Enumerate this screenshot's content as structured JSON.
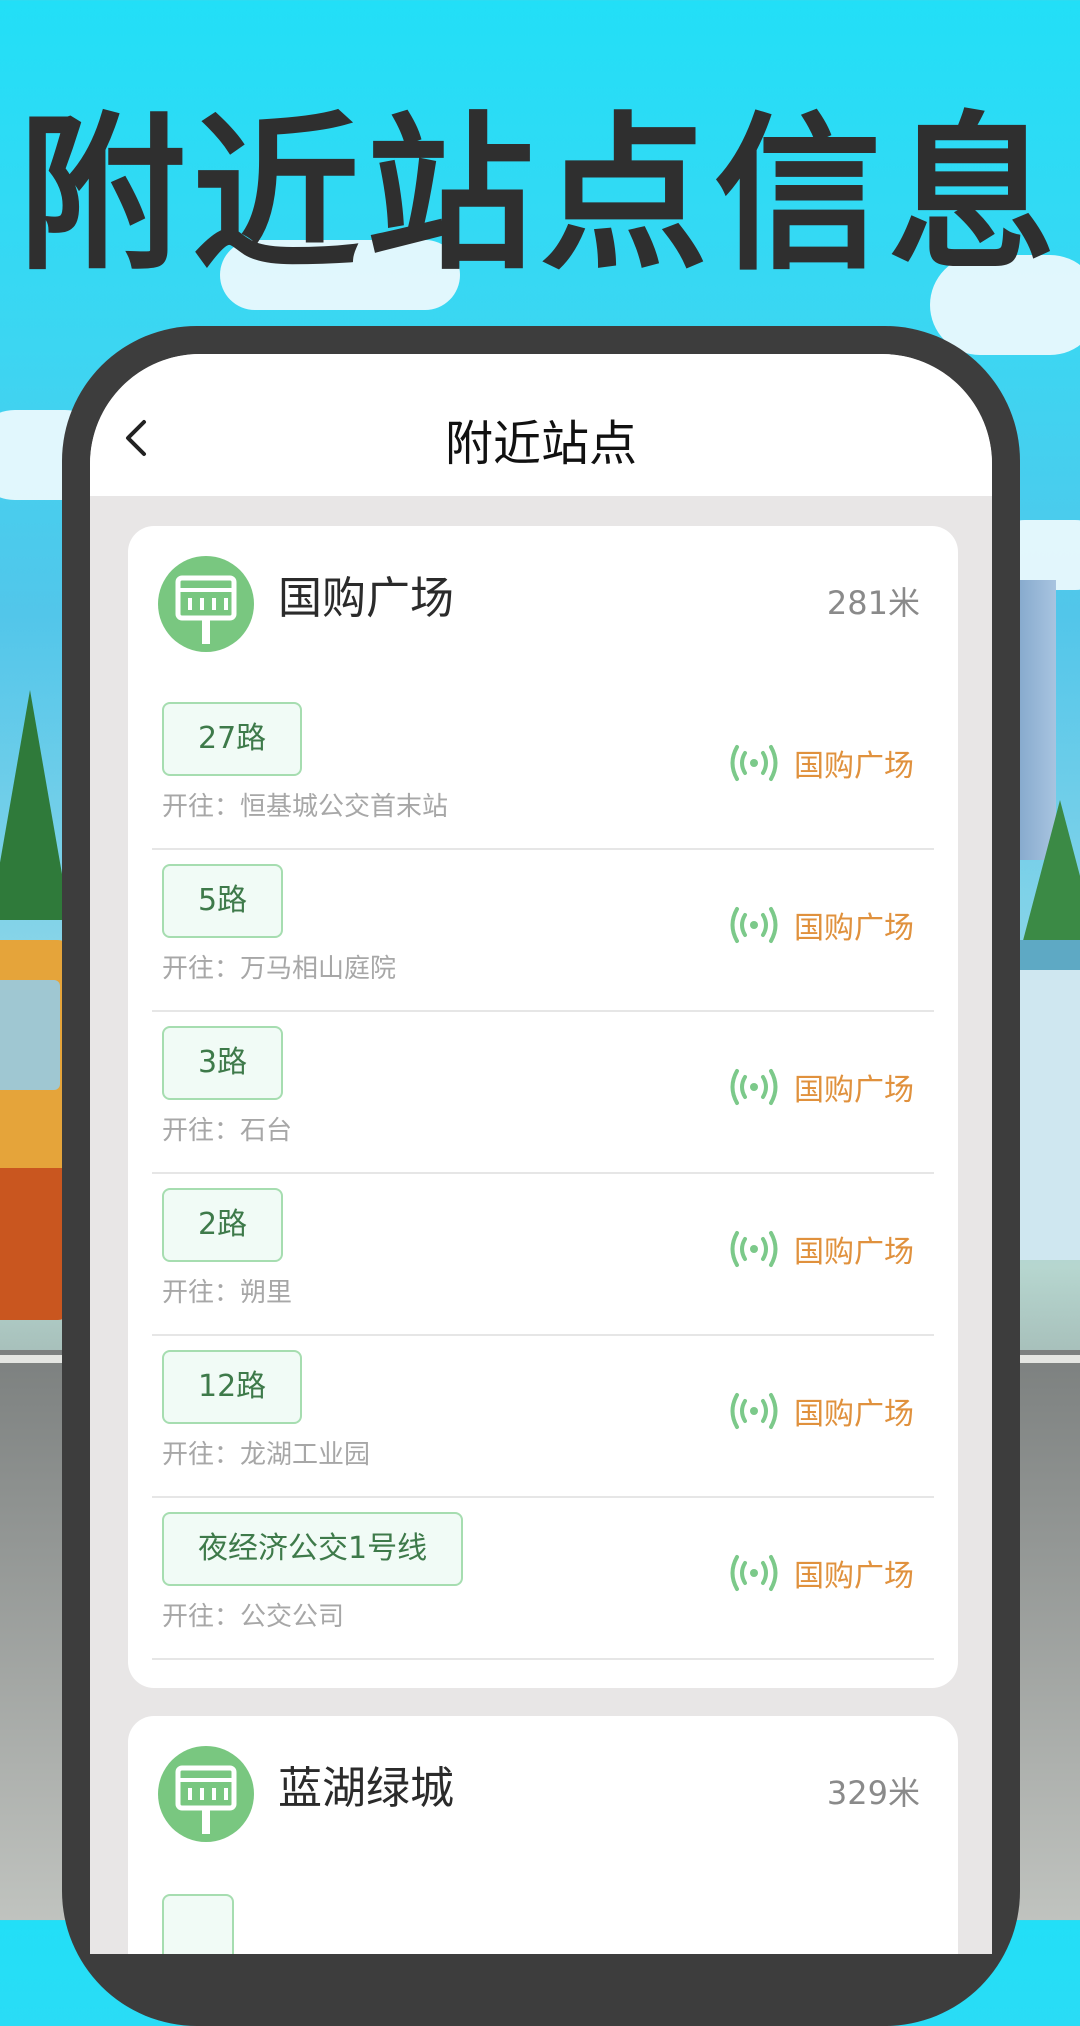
{
  "headline": "附近站点信息",
  "nav": {
    "title": "附近站点",
    "back_icon": "chevron-left-icon"
  },
  "colors": {
    "accent_green": "#79c780",
    "badge_text": "#3e7a4a",
    "live_orange": "#e0913d",
    "live_green": "#7cc98a"
  },
  "stations": [
    {
      "name": "国购广场",
      "distance": "281米",
      "routes": [
        {
          "line": "27路",
          "dest": "开往：恒基城公交首末站",
          "current": "国购广场"
        },
        {
          "line": "5路",
          "dest": "开往：万马相山庭院",
          "current": "国购广场"
        },
        {
          "line": "3路",
          "dest": "开往：石台",
          "current": "国购广场"
        },
        {
          "line": "2路",
          "dest": "开往：朔里",
          "current": "国购广场"
        },
        {
          "line": "12路",
          "dest": "开往：龙湖工业园",
          "current": "国购广场"
        },
        {
          "line": "夜经济公交1号线",
          "dest": "开往：公交公司",
          "current": "国购广场"
        }
      ]
    },
    {
      "name": "蓝湖绿城",
      "distance": "329米",
      "routes": []
    }
  ]
}
